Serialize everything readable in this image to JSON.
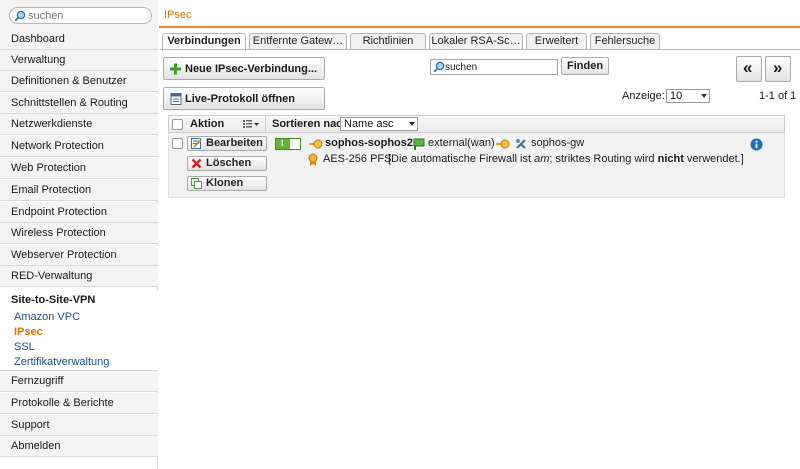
{
  "sidebar": {
    "search_placeholder": "suchen",
    "items": [
      {
        "label": "Dashboard"
      },
      {
        "label": "Verwaltung"
      },
      {
        "label": "Definitionen & Benutzer"
      },
      {
        "label": "Schnittstellen & Routing"
      },
      {
        "label": "Netzwerkdienste"
      },
      {
        "label": "Network Protection"
      },
      {
        "label": "Web Protection"
      },
      {
        "label": "Email Protection"
      },
      {
        "label": "Endpoint Protection"
      },
      {
        "label": "Wireless Protection"
      },
      {
        "label": "Webserver Protection"
      },
      {
        "label": "RED-Verwaltung"
      }
    ],
    "vpn_group": {
      "title": "Site-to-Site-VPN",
      "subitems": [
        {
          "label": "Amazon VPC",
          "active": false
        },
        {
          "label": "IPsec",
          "active": true
        },
        {
          "label": "SSL",
          "active": false
        },
        {
          "label": "Zertifikatverwaltung",
          "active": false
        }
      ]
    },
    "items_after": [
      {
        "label": "Fernzugriff"
      },
      {
        "label": "Protokolle & Berichte"
      },
      {
        "label": "Support"
      },
      {
        "label": "Abmelden"
      }
    ]
  },
  "header": {
    "title": "IPsec"
  },
  "tabs": [
    {
      "label": "Verbindungen",
      "active": true
    },
    {
      "label": "Entfernte Gatew…",
      "active": false
    },
    {
      "label": "Richtlinien",
      "active": false
    },
    {
      "label": "Lokaler RSA-Sc…",
      "active": false
    },
    {
      "label": "Erweitert",
      "active": false
    },
    {
      "label": "Fehlersuche",
      "active": false
    }
  ],
  "toolbar": {
    "new_connection_label": "Neue IPsec-Verbindung...",
    "live_log_label": "Live-Protokoll öffnen",
    "filter_value": "suchen",
    "find_label": "Finden",
    "first_page_label": "«",
    "last_page_label": "»",
    "display_label": "Anzeige:",
    "display_value": "10",
    "page_info": "1-1 of 1"
  },
  "table": {
    "action_header": "Aktion",
    "sort_label": "Sortieren nach:",
    "sort_value": "Name asc",
    "rows": [
      {
        "edit_label": "Bearbeiten",
        "delete_label": "Löschen",
        "clone_label": "Klonen",
        "toggle_label": "I",
        "name": "sophos-sophos2",
        "interface": "external(wan)",
        "gateway": "sophos-gw",
        "policy": "AES-256 PFS",
        "description_before": "[Die automatische Firewall ist ",
        "description_em": "am",
        "description_middle": "; striktes Routing wird ",
        "description_bold": "nicht",
        "description_after": " verwendet.]"
      }
    ]
  },
  "colors": {
    "accent": "#e07400",
    "header_border": "#e8892f",
    "link": "#1b4f8c",
    "toggle_green": "#5cb82e",
    "info_blue": "#1b6fc7"
  }
}
